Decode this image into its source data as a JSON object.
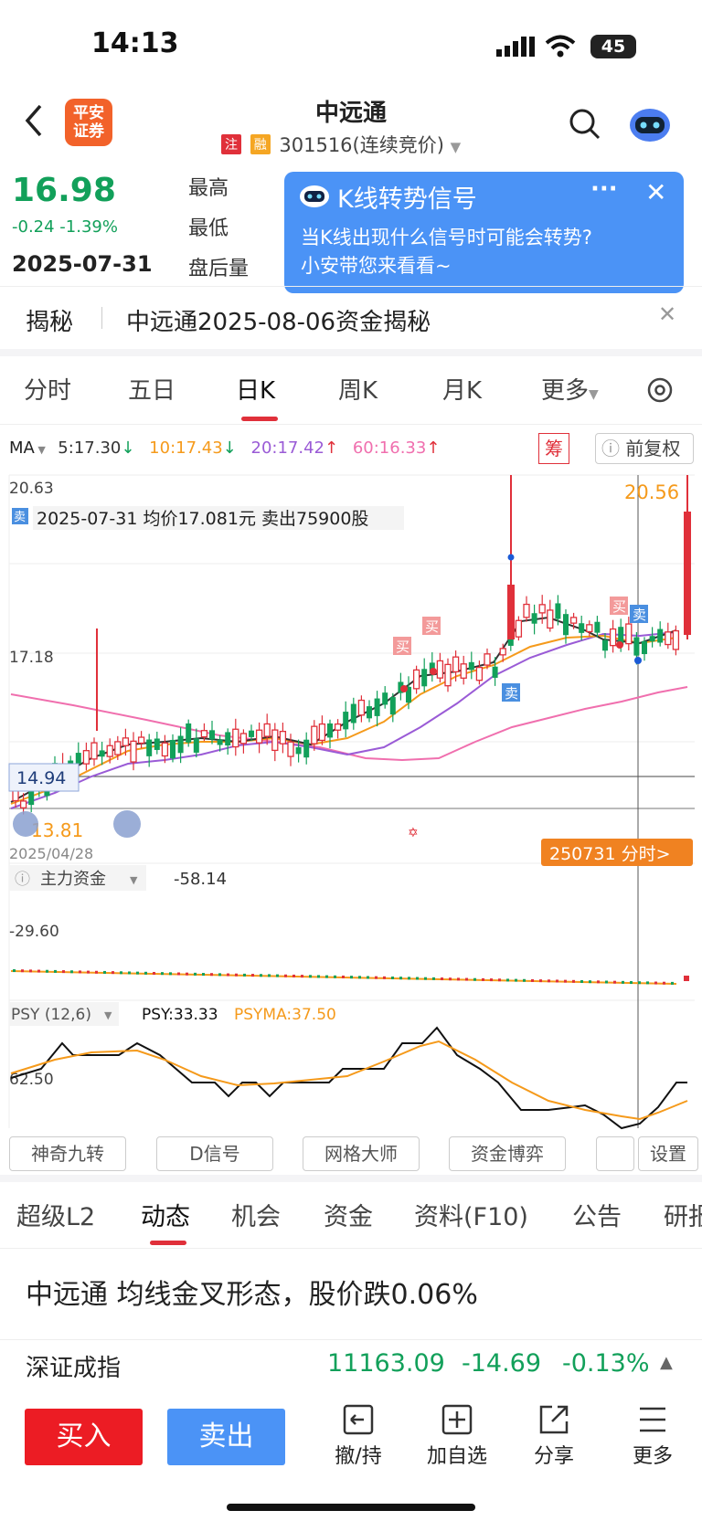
{
  "status_bar": {
    "time": "14:13",
    "battery": "45"
  },
  "header": {
    "logo": "平安\n证券",
    "name": "中远通",
    "tag_zhu": "注",
    "tag_rong": "融",
    "code": "301516(连续竞价)"
  },
  "quote": {
    "price": "16.98",
    "change": "-0.24 -1.39%",
    "date": "2025-07-31",
    "labels": [
      "最高",
      "最低",
      "盘后量"
    ]
  },
  "popup": {
    "title": "K线转势信号",
    "text1": "当K线出现什么信号时可能会转势?",
    "text2": "小安带您来看看~"
  },
  "reveal": {
    "label": "揭秘",
    "text": "中远通2025-08-06资金揭秘"
  },
  "period_tabs": [
    "分时",
    "五日",
    "日K",
    "周K",
    "月K",
    "更多"
  ],
  "active_period": "日K",
  "ma_bar": {
    "label": "MA",
    "ma5": "5:17.30",
    "ma10": "10:17.43",
    "ma20": "20:17.42",
    "ma60": "60:16.33",
    "chou": "筹",
    "fq": "前复权"
  },
  "kline": {
    "top_price": "20.63",
    "mid_price": "17.18",
    "cursor_price": "14.94",
    "low_price": "13.81",
    "high_label": "20.56",
    "info": "2025-07-31 均价17.081元 卖出75900股",
    "start_date": "2025/04/28",
    "fs_button": "250731 分时>",
    "buy_mark": "买",
    "sell_mark": "卖"
  },
  "fund": {
    "label": "主力资金",
    "value": "-58.14",
    "axis": "-29.60"
  },
  "psy": {
    "label": "PSY (12,6)",
    "psy": "PSY:33.33",
    "psyma": "PSYMA:37.50",
    "axis": "62.50"
  },
  "tool_buttons": [
    "神奇九转",
    "D信号",
    "网格大师",
    "资金博弈",
    "设置"
  ],
  "detail_tabs": [
    "超级L2",
    "动态",
    "机会",
    "资金",
    "资料(F10)",
    "公告",
    "研报"
  ],
  "active_detail": "动态",
  "news": {
    "text": "中远通 均线金叉形态，股价跌0.06%"
  },
  "index": {
    "name": "深证成指",
    "value": "11163.09",
    "change": "-14.69",
    "pct": "-0.13%"
  },
  "bottom_bar": {
    "buy": "买入",
    "sell": "卖出",
    "items": [
      "撤/持",
      "加自选",
      "分享",
      "更多"
    ]
  },
  "colors": {
    "up": "#e0303a",
    "down": "#12a05a",
    "ma5": "#333333",
    "ma10": "#f59a1b",
    "ma20": "#9a5bd6",
    "ma60": "#f06fae",
    "accent": "#f2622a",
    "popup": "#4b93f6"
  }
}
